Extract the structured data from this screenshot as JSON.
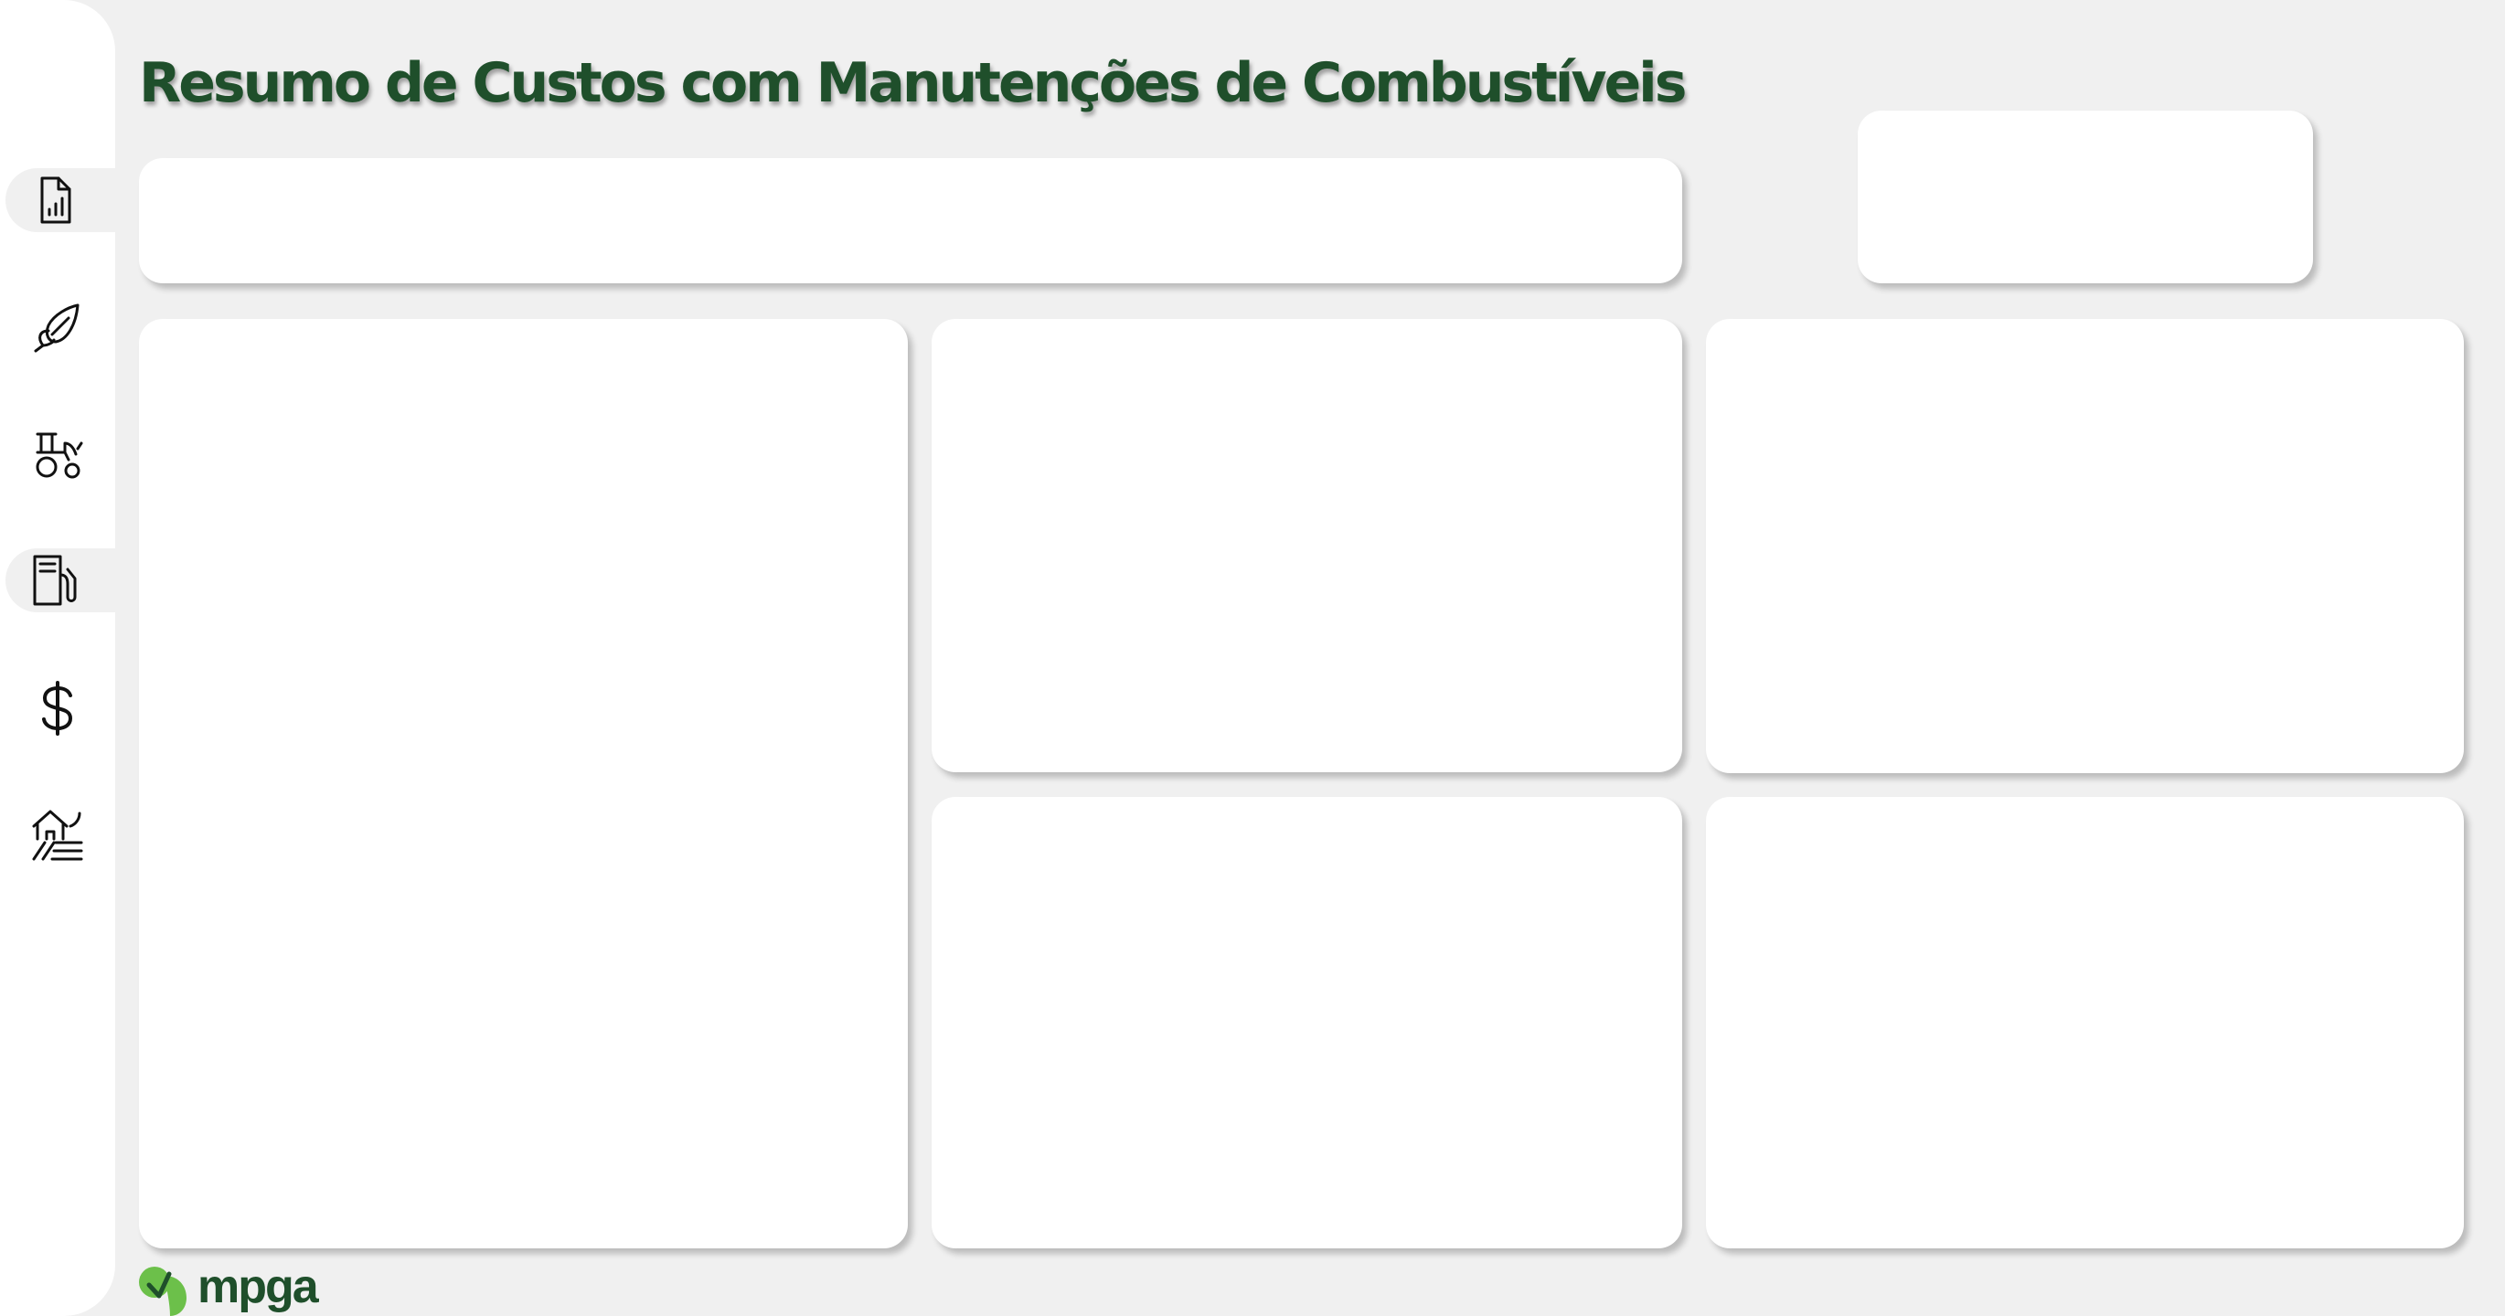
{
  "header": {
    "title": "Resumo de Custos com Manutenções de Combustíveis"
  },
  "sidebar": {
    "items": [
      {
        "icon": "report-chart-icon",
        "active": false
      },
      {
        "icon": "corn-icon",
        "active": false
      },
      {
        "icon": "tractor-icon",
        "active": false
      },
      {
        "icon": "fuel-pump-icon",
        "active": true
      },
      {
        "icon": "dollar-icon",
        "active": false
      },
      {
        "icon": "farm-icon",
        "active": false
      }
    ]
  },
  "footer": {
    "brand_name": "mpga"
  },
  "colors": {
    "page_background": "#f0f0f0",
    "title_green": "#1f4f2b",
    "brand_green": "#6cc04a",
    "card_background": "#ffffff"
  }
}
